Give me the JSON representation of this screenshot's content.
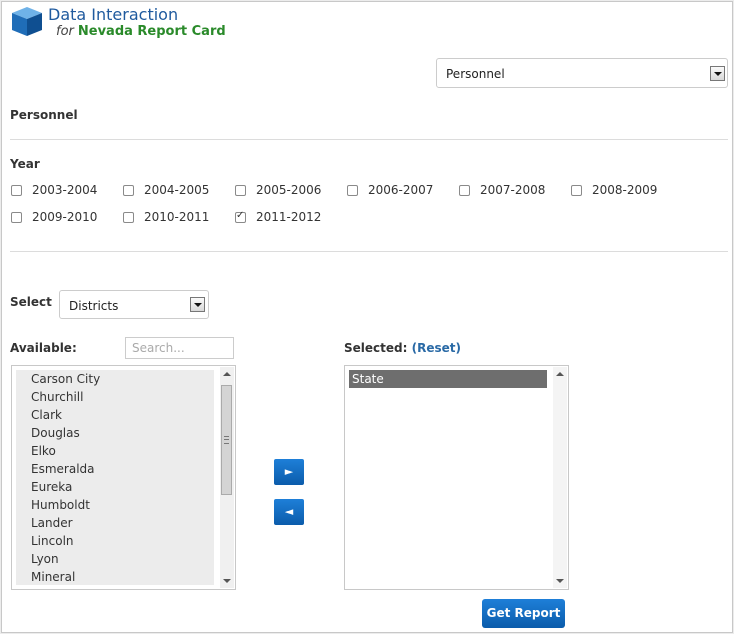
{
  "header": {
    "title": "Data Interaction",
    "subtitle_for": "for",
    "subtitle_brand": "Nevada Report Card"
  },
  "report_select": {
    "value": "Personnel"
  },
  "section_title": "Personnel",
  "year": {
    "label": "Year",
    "options": [
      {
        "label": "2003-2004",
        "checked": false
      },
      {
        "label": "2004-2005",
        "checked": false
      },
      {
        "label": "2005-2006",
        "checked": false
      },
      {
        "label": "2006-2007",
        "checked": false
      },
      {
        "label": "2007-2008",
        "checked": false
      },
      {
        "label": "2008-2009",
        "checked": false
      },
      {
        "label": "2009-2010",
        "checked": false
      },
      {
        "label": "2010-2011",
        "checked": false
      },
      {
        "label": "2011-2012",
        "checked": true
      }
    ]
  },
  "select_type": {
    "label": "Select",
    "value": "Districts"
  },
  "available": {
    "label": "Available:",
    "search_placeholder": "Search...",
    "items": [
      "Carson City",
      "Churchill",
      "Clark",
      "Douglas",
      "Elko",
      "Esmeralda",
      "Eureka",
      "Humboldt",
      "Lander",
      "Lincoln",
      "Lyon",
      "Mineral"
    ]
  },
  "selected": {
    "label": "Selected:",
    "reset_label": "(Reset)",
    "items": [
      "State"
    ]
  },
  "buttons": {
    "add_icon": "right-arrow-icon",
    "remove_icon": "left-arrow-icon",
    "add_glyph": "►",
    "remove_glyph": "◄",
    "get_report": "Get Report"
  },
  "colors": {
    "title_blue": "#1f5a9e",
    "brand_green": "#2a8a2a",
    "button_blue": "#0b5cab",
    "selected_item_bg": "#6e6e6e"
  }
}
